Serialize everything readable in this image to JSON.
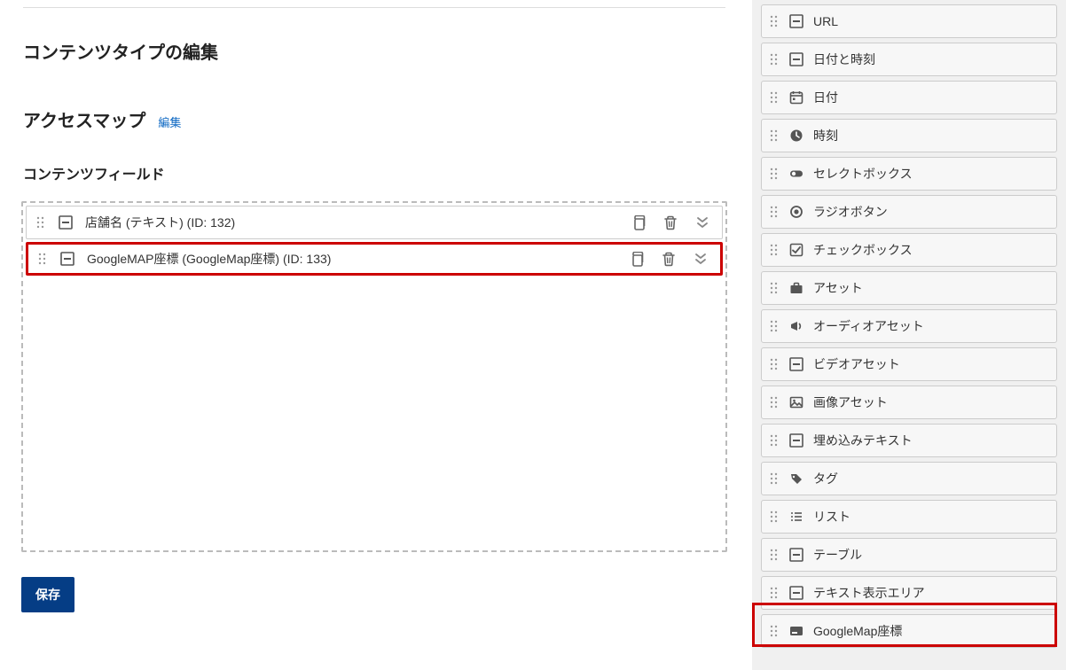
{
  "main": {
    "page_title": "コンテンツタイプの編集",
    "section_title": "アクセスマップ",
    "edit_link": "編集",
    "fields_heading": "コンテンツフィールド",
    "fields": [
      {
        "label": "店舗名 (テキスト) (ID: 132)"
      },
      {
        "label": "GoogleMAP座標 (GoogleMap座標) (ID: 133)"
      }
    ],
    "save_label": "保存"
  },
  "sidebar": {
    "items": [
      {
        "icon": "text-box",
        "label": "URL"
      },
      {
        "icon": "text-box",
        "label": "日付と時刻"
      },
      {
        "icon": "calendar",
        "label": "日付"
      },
      {
        "icon": "clock",
        "label": "時刻"
      },
      {
        "icon": "toggle",
        "label": "セレクトボックス"
      },
      {
        "icon": "radio",
        "label": "ラジオボタン"
      },
      {
        "icon": "checkbox",
        "label": "チェックボックス"
      },
      {
        "icon": "briefcase",
        "label": "アセット"
      },
      {
        "icon": "megaphone",
        "label": "オーディオアセット"
      },
      {
        "icon": "text-box",
        "label": "ビデオアセット"
      },
      {
        "icon": "image",
        "label": "画像アセット"
      },
      {
        "icon": "text-box",
        "label": "埋め込みテキスト"
      },
      {
        "icon": "tag",
        "label": "タグ"
      },
      {
        "icon": "list",
        "label": "リスト"
      },
      {
        "icon": "text-box",
        "label": "テーブル"
      },
      {
        "icon": "text-box",
        "label": "テキスト表示エリア"
      },
      {
        "icon": "card",
        "label": "GoogleMap座標"
      }
    ]
  }
}
